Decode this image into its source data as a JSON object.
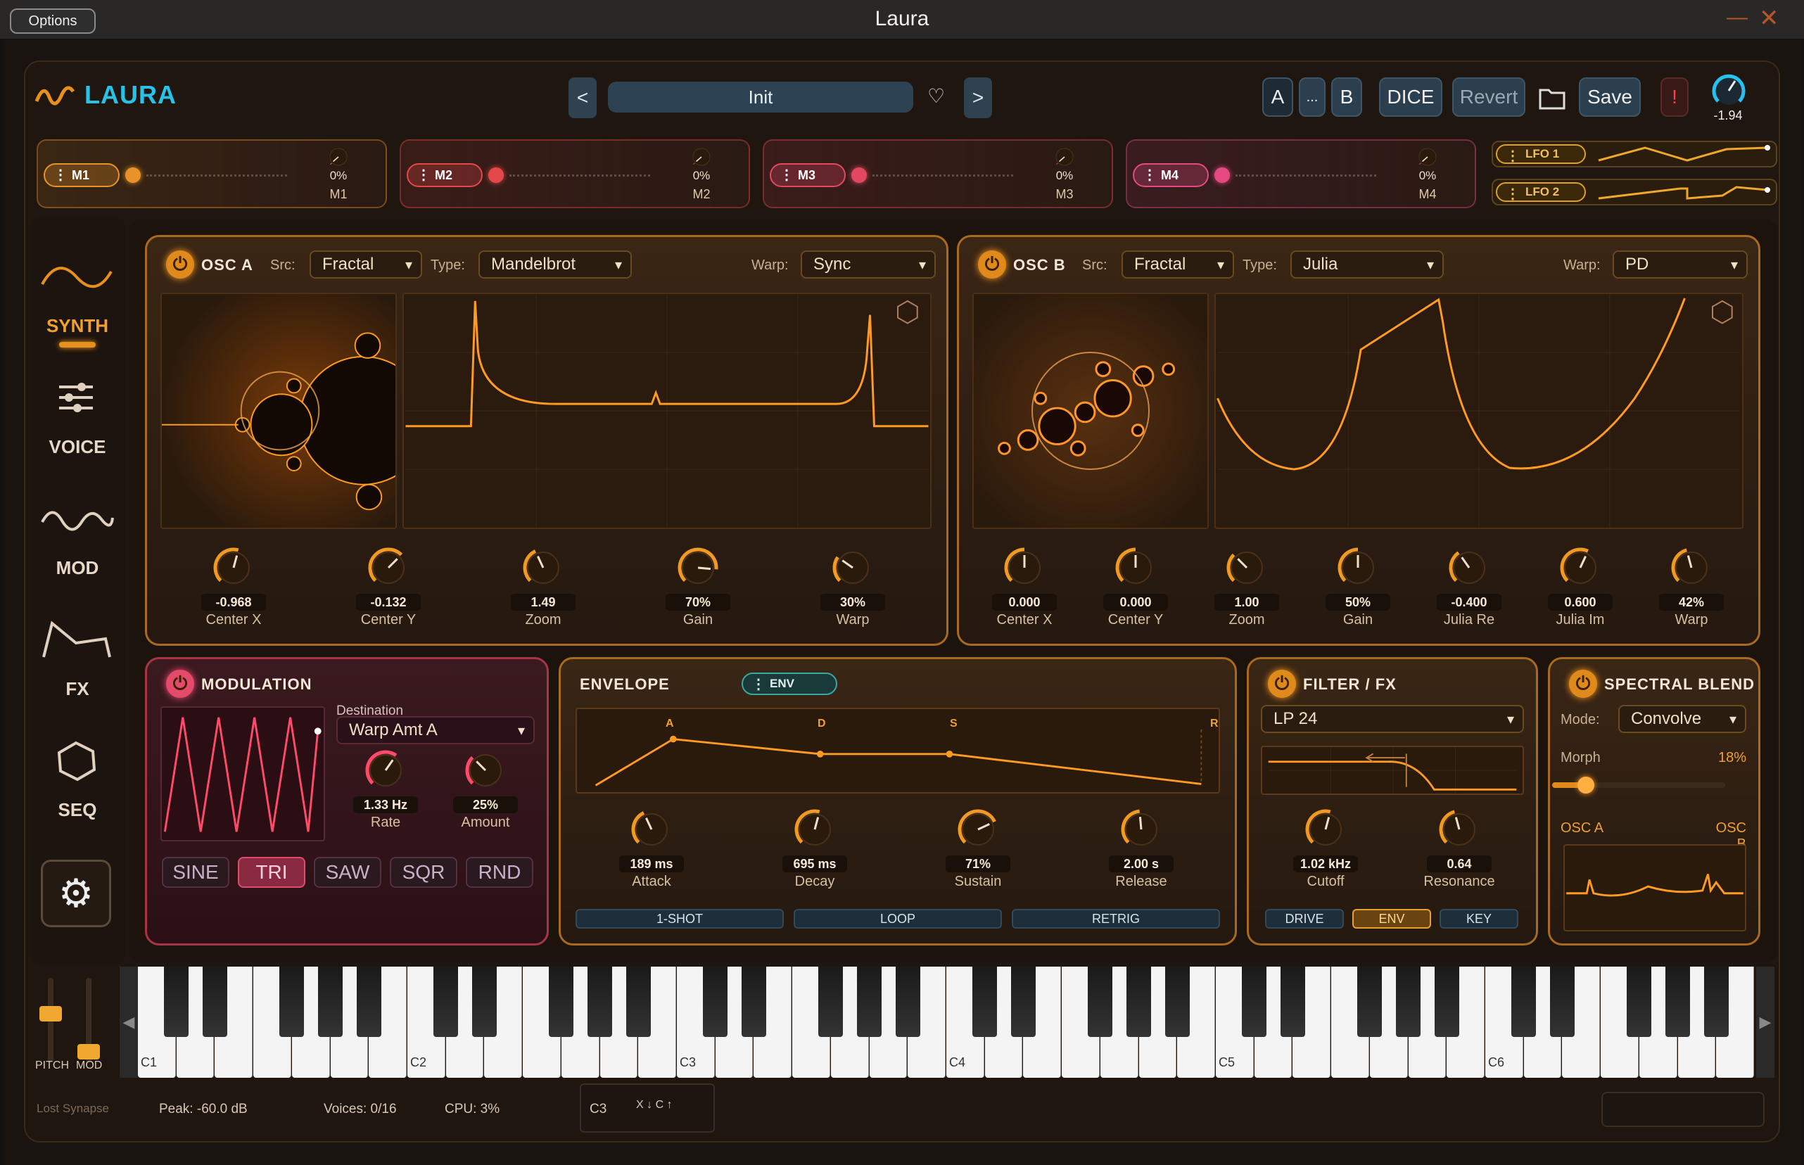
{
  "window": {
    "options": "Options",
    "title": "Laura"
  },
  "header": {
    "logo": "LAURA",
    "preset": "Init",
    "prev": "<",
    "next": ">",
    "btn_a": "A",
    "btn_dots": "...",
    "btn_b": "B",
    "dice": "DICE",
    "revert": "Revert",
    "save": "Save",
    "alert": "!",
    "master_value": "-1.94"
  },
  "macros": [
    {
      "label": "M1",
      "pct": "0%",
      "name": "M1",
      "color": "#e8922a"
    },
    {
      "label": "M2",
      "pct": "0%",
      "name": "M2",
      "color": "#e4484a"
    },
    {
      "label": "M3",
      "pct": "0%",
      "name": "M3",
      "color": "#e44860"
    },
    {
      "label": "M4",
      "pct": "0%",
      "name": "M4",
      "color": "#e44a80"
    }
  ],
  "lfos": [
    {
      "label": "LFO 1"
    },
    {
      "label": "LFO 2"
    }
  ],
  "sidebar": {
    "synth": "SYNTH",
    "voice": "VOICE",
    "mod": "MOD",
    "fx": "FX",
    "seq": "SEQ"
  },
  "osc_a": {
    "title": "OSC A",
    "src_label": "Src:",
    "src": "Fractal",
    "type_label": "Type:",
    "type": "Mandelbrot",
    "warp_label": "Warp:",
    "warp": "Sync",
    "knobs": [
      {
        "value": "-0.968",
        "label": "Center X"
      },
      {
        "value": "-0.132",
        "label": "Center Y"
      },
      {
        "value": "1.49",
        "label": "Zoom"
      },
      {
        "value": "70%",
        "label": "Gain"
      },
      {
        "value": "30%",
        "label": "Warp"
      }
    ]
  },
  "osc_b": {
    "title": "OSC B",
    "src_label": "Src:",
    "src": "Fractal",
    "type_label": "Type:",
    "type": "Julia",
    "warp_label": "Warp:",
    "warp": "PD",
    "knobs": [
      {
        "value": "0.000",
        "label": "Center X"
      },
      {
        "value": "0.000",
        "label": "Center Y"
      },
      {
        "value": "1.00",
        "label": "Zoom"
      },
      {
        "value": "50%",
        "label": "Gain"
      },
      {
        "value": "-0.400",
        "label": "Julia Re"
      },
      {
        "value": "0.600",
        "label": "Julia Im"
      },
      {
        "value": "42%",
        "label": "Warp"
      }
    ]
  },
  "modulation": {
    "title": "MODULATION",
    "dest_label": "Destination",
    "dest": "Warp Amt A",
    "rate": "1.33 Hz",
    "rate_label": "Rate",
    "amount": "25%",
    "amount_label": "Amount",
    "waves": [
      "SINE",
      "TRI",
      "SAW",
      "SQR",
      "RND"
    ],
    "active_wave": "TRI"
  },
  "envelope": {
    "title": "ENVELOPE",
    "tag": "ENV",
    "points": [
      "A",
      "D",
      "S",
      "R"
    ],
    "knobs": [
      {
        "value": "189 ms",
        "label": "Attack"
      },
      {
        "value": "695 ms",
        "label": "Decay"
      },
      {
        "value": "71%",
        "label": "Sustain"
      },
      {
        "value": "2.00 s",
        "label": "Release"
      }
    ],
    "modes": [
      "1-SHOT",
      "LOOP",
      "RETRIG"
    ]
  },
  "filter": {
    "title": "FILTER / FX",
    "type": "LP 24",
    "cutoff": "1.02 kHz",
    "cutoff_label": "Cutoff",
    "res": "0.64",
    "res_label": "Resonance",
    "buttons": [
      "DRIVE",
      "ENV",
      "KEY"
    ],
    "active": "ENV"
  },
  "spectral": {
    "title": "SPECTRAL BLEND",
    "mode_label": "Mode:",
    "mode": "Convolve",
    "morph_label": "Morph",
    "morph_value": "18%",
    "morph": 0.18,
    "left": "OSC A",
    "right": "OSC B"
  },
  "keyboard": {
    "octaves": [
      "C1",
      "C2",
      "C3",
      "C4",
      "C5",
      "C6"
    ],
    "pitch": "PITCH",
    "mod": "MOD"
  },
  "status": {
    "brand": "Lost Synapse",
    "peak": "Peak: -60.0 dB",
    "voices": "Voices: 0/16",
    "cpu": "CPU: 3%",
    "note": "C3",
    "keys": "X ↓   C ↑"
  }
}
